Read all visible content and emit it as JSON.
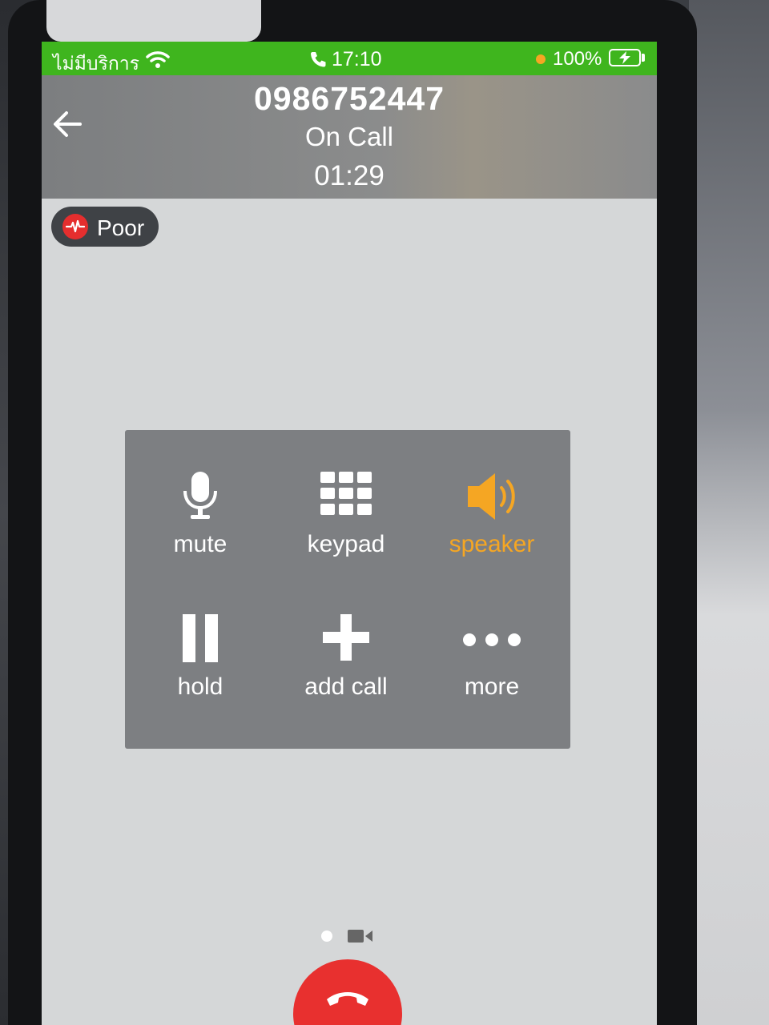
{
  "status_bar": {
    "carrier": "ไม่มีบริการ",
    "time": "17:10",
    "battery": "100%",
    "bar_color": "#3fb51e"
  },
  "call": {
    "number": "0986752447",
    "status": "On Call",
    "duration": "01:29"
  },
  "quality": {
    "label": "Poor",
    "icon": "signal-wave-icon",
    "icon_color": "#e52e2e"
  },
  "controls": [
    {
      "label": "mute",
      "icon": "microphone-icon",
      "active": false
    },
    {
      "label": "keypad",
      "icon": "keypad-icon",
      "active": false
    },
    {
      "label": "speaker",
      "icon": "speaker-icon",
      "active": true
    },
    {
      "label": "hold",
      "icon": "pause-icon",
      "active": false
    },
    {
      "label": "add call",
      "icon": "plus-icon",
      "active": false
    },
    {
      "label": "more",
      "icon": "more-dots-icon",
      "active": false
    }
  ],
  "colors": {
    "active_accent": "#f5a623",
    "end_call": "#e8302f"
  },
  "pager": {
    "pages": 2,
    "current": 1
  }
}
